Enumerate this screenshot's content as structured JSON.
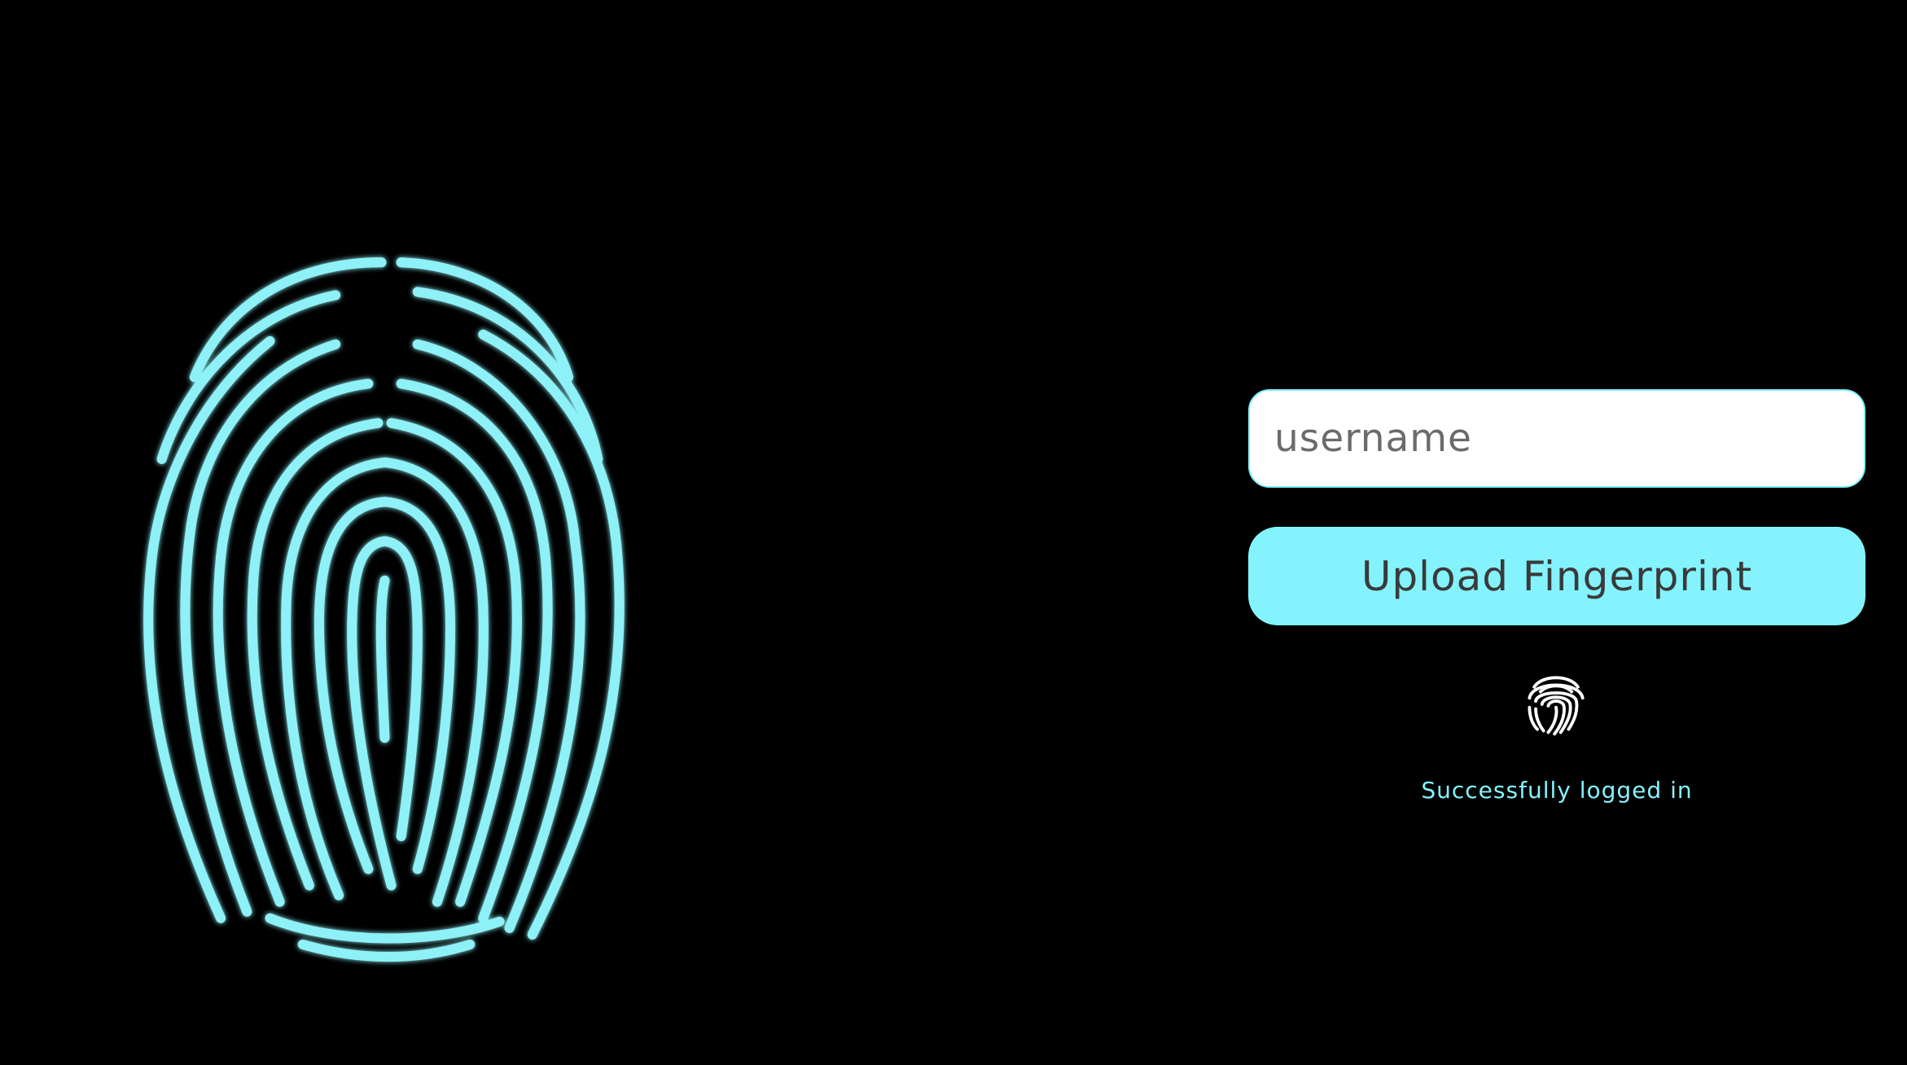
{
  "login": {
    "username_placeholder": "username",
    "username_value": "",
    "upload_label": "Upload Fingerprint",
    "status_text": "Successfully logged in"
  },
  "icons": {
    "hero": "fingerprint-icon",
    "status": "fingerprint-icon"
  },
  "colors": {
    "background": "#000000",
    "accent": "#84f3fd",
    "input_background": "#ffffff",
    "button_text": "#3a3a3a"
  }
}
